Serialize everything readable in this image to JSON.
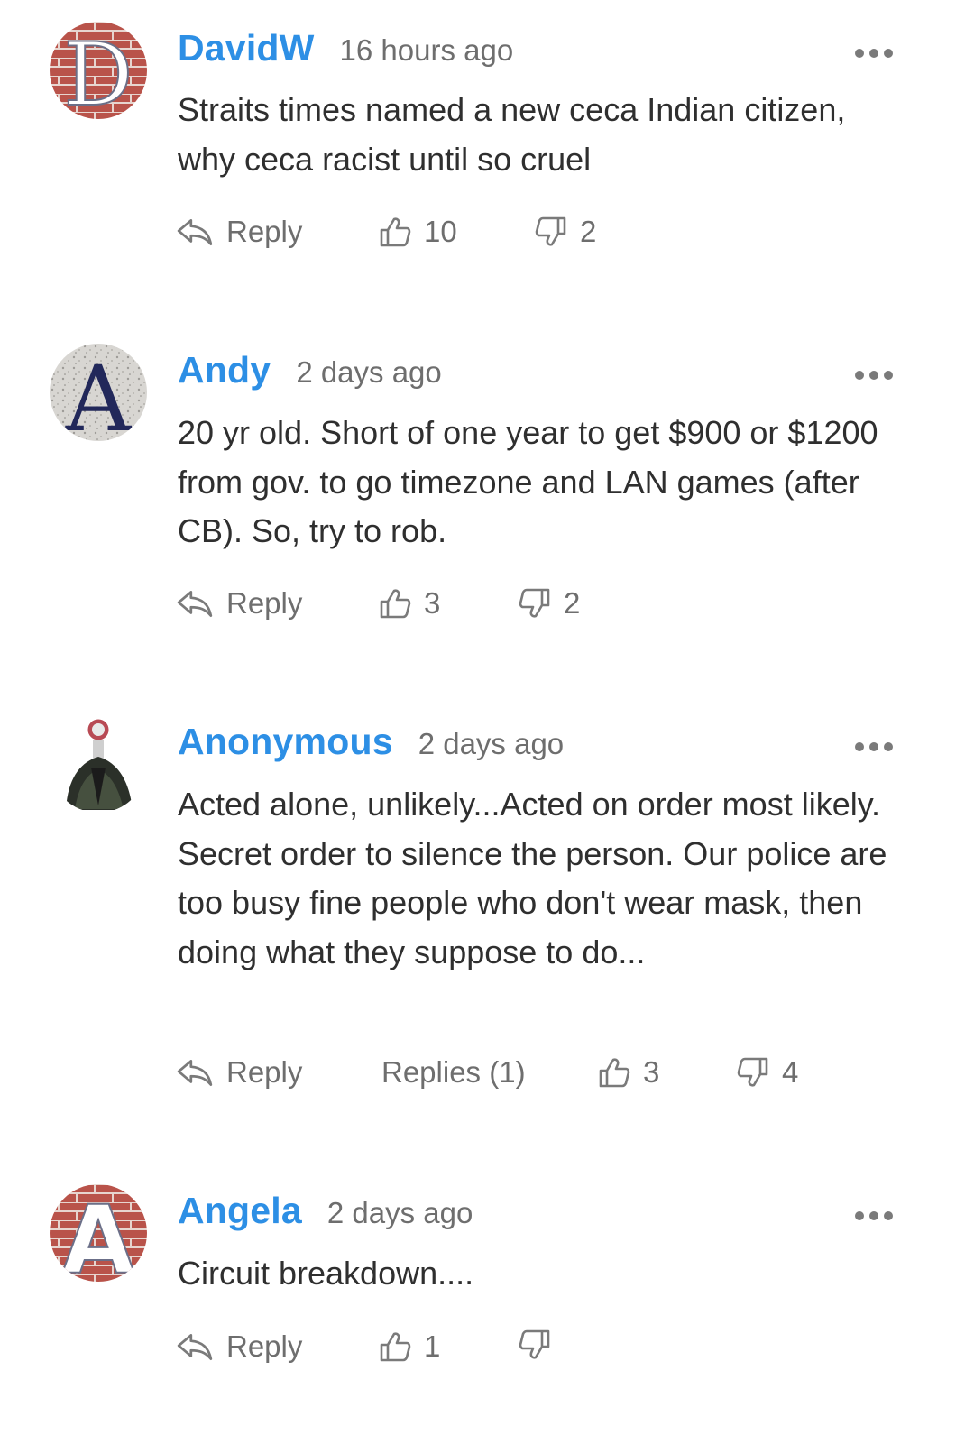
{
  "comments": [
    {
      "author": "DavidW",
      "time": "16 hours ago",
      "text": "Straits times named a new ceca Indian citizen, why ceca racist until so cruel",
      "reply_label": "Reply",
      "likes": "10",
      "dislikes": "2"
    },
    {
      "author": "Andy",
      "time": "2 days ago",
      "text": "20 yr old. Short of one year to get $900 or $1200 from gov. to go timezone and LAN games (after CB). So, try to rob.",
      "reply_label": "Reply",
      "likes": "3",
      "dislikes": "2"
    },
    {
      "author": "Anonymous",
      "time": "2 days ago",
      "text": "Acted alone, unlikely...Acted on order most likely. Secret order to silence the person. Our police are too busy fine people who don't wear mask, then doing what they suppose to do...",
      "reply_label": "Reply",
      "replies_label": "Replies (1)",
      "likes": "3",
      "dislikes": "4"
    },
    {
      "author": "Angela",
      "time": "2 days ago",
      "text": "Circuit breakdown....",
      "reply_label": "Reply",
      "likes": "1",
      "dislikes": ""
    }
  ],
  "avatars": [
    {
      "letter": "D"
    },
    {
      "letter": "A"
    },
    {
      "letter": ""
    },
    {
      "letter": "A"
    }
  ],
  "colors": {
    "author": "#2d8fe5",
    "meta": "#6e6e6e",
    "text": "#2f2f2f"
  },
  "icons": [
    "reply-icon",
    "thumbs-up-icon",
    "thumbs-down-icon",
    "more-options-icon"
  ]
}
